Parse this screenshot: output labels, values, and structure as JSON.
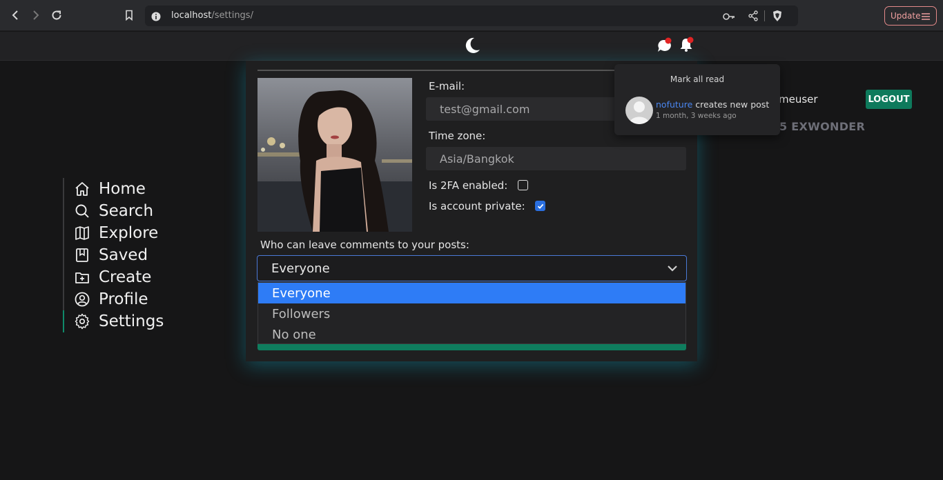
{
  "browser": {
    "url_host": "localhost",
    "url_path": "/settings/",
    "update_label": "Update"
  },
  "sidebar": {
    "items": [
      {
        "label": "Home",
        "icon": "home-icon"
      },
      {
        "label": "Search",
        "icon": "search-icon"
      },
      {
        "label": "Explore",
        "icon": "map-icon"
      },
      {
        "label": "Saved",
        "icon": "bookmark-icon"
      },
      {
        "label": "Create",
        "icon": "folder-plus-icon"
      },
      {
        "label": "Profile",
        "icon": "user-circle-icon"
      },
      {
        "label": "Settings",
        "icon": "gear-icon"
      }
    ],
    "active": "Settings"
  },
  "settings": {
    "email_label": "E-mail:",
    "email_value": "test@gmail.com",
    "timezone_label": "Time zone:",
    "timezone_value": "Asia/Bangkok",
    "twofa_label": "Is 2FA enabled:",
    "twofa_checked": false,
    "private_label": "Is account private:",
    "private_checked": true,
    "comments_label": "Who can leave comments to your posts:",
    "comments_selected": "Everyone",
    "comments_options": [
      "Everyone",
      "Followers",
      "No one"
    ]
  },
  "header": {
    "username_partial": "meuser",
    "logout_label": "LOGOUT",
    "brand_partial": "5 EXWONDER"
  },
  "notifications": {
    "mark_all_label": "Mark all read",
    "items": [
      {
        "user": "nofuture",
        "text": " creates new post",
        "time": "1 month, 3 weeks ago"
      }
    ]
  },
  "colors": {
    "accent_green": "#0f7d5e",
    "select_blue": "#2e7cf6",
    "badge_red": "#e02424",
    "glow": "#14bedc"
  }
}
